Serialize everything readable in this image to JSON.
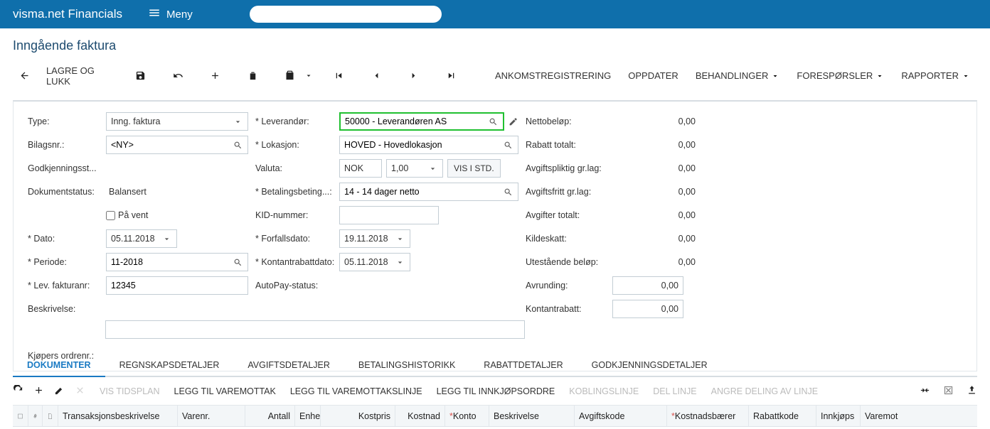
{
  "topbar": {
    "brand": "visma.net Financials",
    "menu": "Meny"
  },
  "page_title": "Inngående faktura",
  "toolbar": {
    "save_close": "LAGRE OG LUKK",
    "reception": "ANKOMSTREGISTRERING",
    "update": "OPPDATER",
    "actions": "BEHANDLINGER",
    "inquiries": "FORESPØRSLER",
    "reports": "RAPPORTER"
  },
  "form": {
    "type_lbl": "Type:",
    "type_val": "Inng. faktura",
    "bilag_lbl": "Bilagsnr.:",
    "bilag_val": "<NY>",
    "godkj_lbl": "Godkjenningsst...",
    "docstat_lbl": "Dokumentstatus:",
    "docstat_val": "Balansert",
    "hold_lbl": "På vent",
    "dato_lbl": "Dato:",
    "dato_val": "05.11.2018",
    "periode_lbl": "Periode:",
    "periode_val": "11-2018",
    "levfakt_lbl": "Lev. fakturanr:",
    "levfakt_val": "12345",
    "besk_lbl": "Beskrivelse:",
    "besk_val": "",
    "kjoper_lbl": "Kjøpers ordrenr.:",
    "lev_lbl": "Leverandør:",
    "lev_val": "50000 - Leverandøren AS",
    "lok_lbl": "Lokasjon:",
    "lok_val": "HOVED - Hovedlokasjon",
    "valuta_lbl": "Valuta:",
    "valuta_code": "NOK",
    "valuta_rate": "1,00",
    "valuta_btn": "VIS I STD.",
    "bet_lbl": "Betalingsbeting...:",
    "bet_val": "14 - 14 dager netto",
    "kid_lbl": "KID-nummer:",
    "forfall_lbl": "Forfallsdato:",
    "forfall_val": "19.11.2018",
    "kontr_lbl": "Kontantrabattdato:",
    "kontr_val": "05.11.2018",
    "autopay_lbl": "AutoPay-status:",
    "netto_lbl": "Nettobeløp:",
    "netto_val": "0,00",
    "rabtot_lbl": "Rabatt totalt:",
    "rabtot_val": "0,00",
    "avgpl_lbl": "Avgiftspliktig gr.lag:",
    "avgpl_val": "0,00",
    "avgfr_lbl": "Avgiftsfritt gr.lag:",
    "avgfr_val": "0,00",
    "avgtot_lbl": "Avgifter totalt:",
    "avgtot_val": "0,00",
    "kilde_lbl": "Kildeskatt:",
    "kilde_val": "0,00",
    "utest_lbl": "Utestående beløp:",
    "utest_val": "0,00",
    "avr_lbl": "Avrunding:",
    "avr_val": "0,00",
    "konrab_lbl": "Kontantrabatt:",
    "konrab_val": "0,00"
  },
  "tabs": [
    "DOKUMENTER",
    "REGNSKAPSDETALJER",
    "AVGIFTSDETALJER",
    "BETALINGSHISTORIKK",
    "RABATTDETALJER",
    "GODKJENNINGSDETALJER"
  ],
  "gridbar": {
    "vis_tidsplan": "VIS TIDSPLAN",
    "legg_varemottak": "LEGG TIL VAREMOTTAK",
    "legg_varemottakslinje": "LEGG TIL VAREMOTTAKSLINJE",
    "legg_innkjop": "LEGG TIL INNKJØPSORDRE",
    "koblingslinje": "KOBLINGSLINJE",
    "del_linje": "DEL LINJE",
    "angre_deling": "ANGRE DELING AV LINJE"
  },
  "grid_cols": {
    "trans": "Transaksjonsbeskrivelse",
    "varenr": "Varenr.",
    "antall": "Antall",
    "enhet": "Enhe",
    "kostpris": "Kostpris",
    "kostnad": "Kostnad",
    "konto": "Konto",
    "besk": "Beskrivelse",
    "avgiftskode": "Avgiftskode",
    "kostnadsbaerer": "Kostnadsbærer",
    "rabattkode": "Rabattkode",
    "innkjops": "Innkjøps",
    "varemot": "Varemot"
  }
}
